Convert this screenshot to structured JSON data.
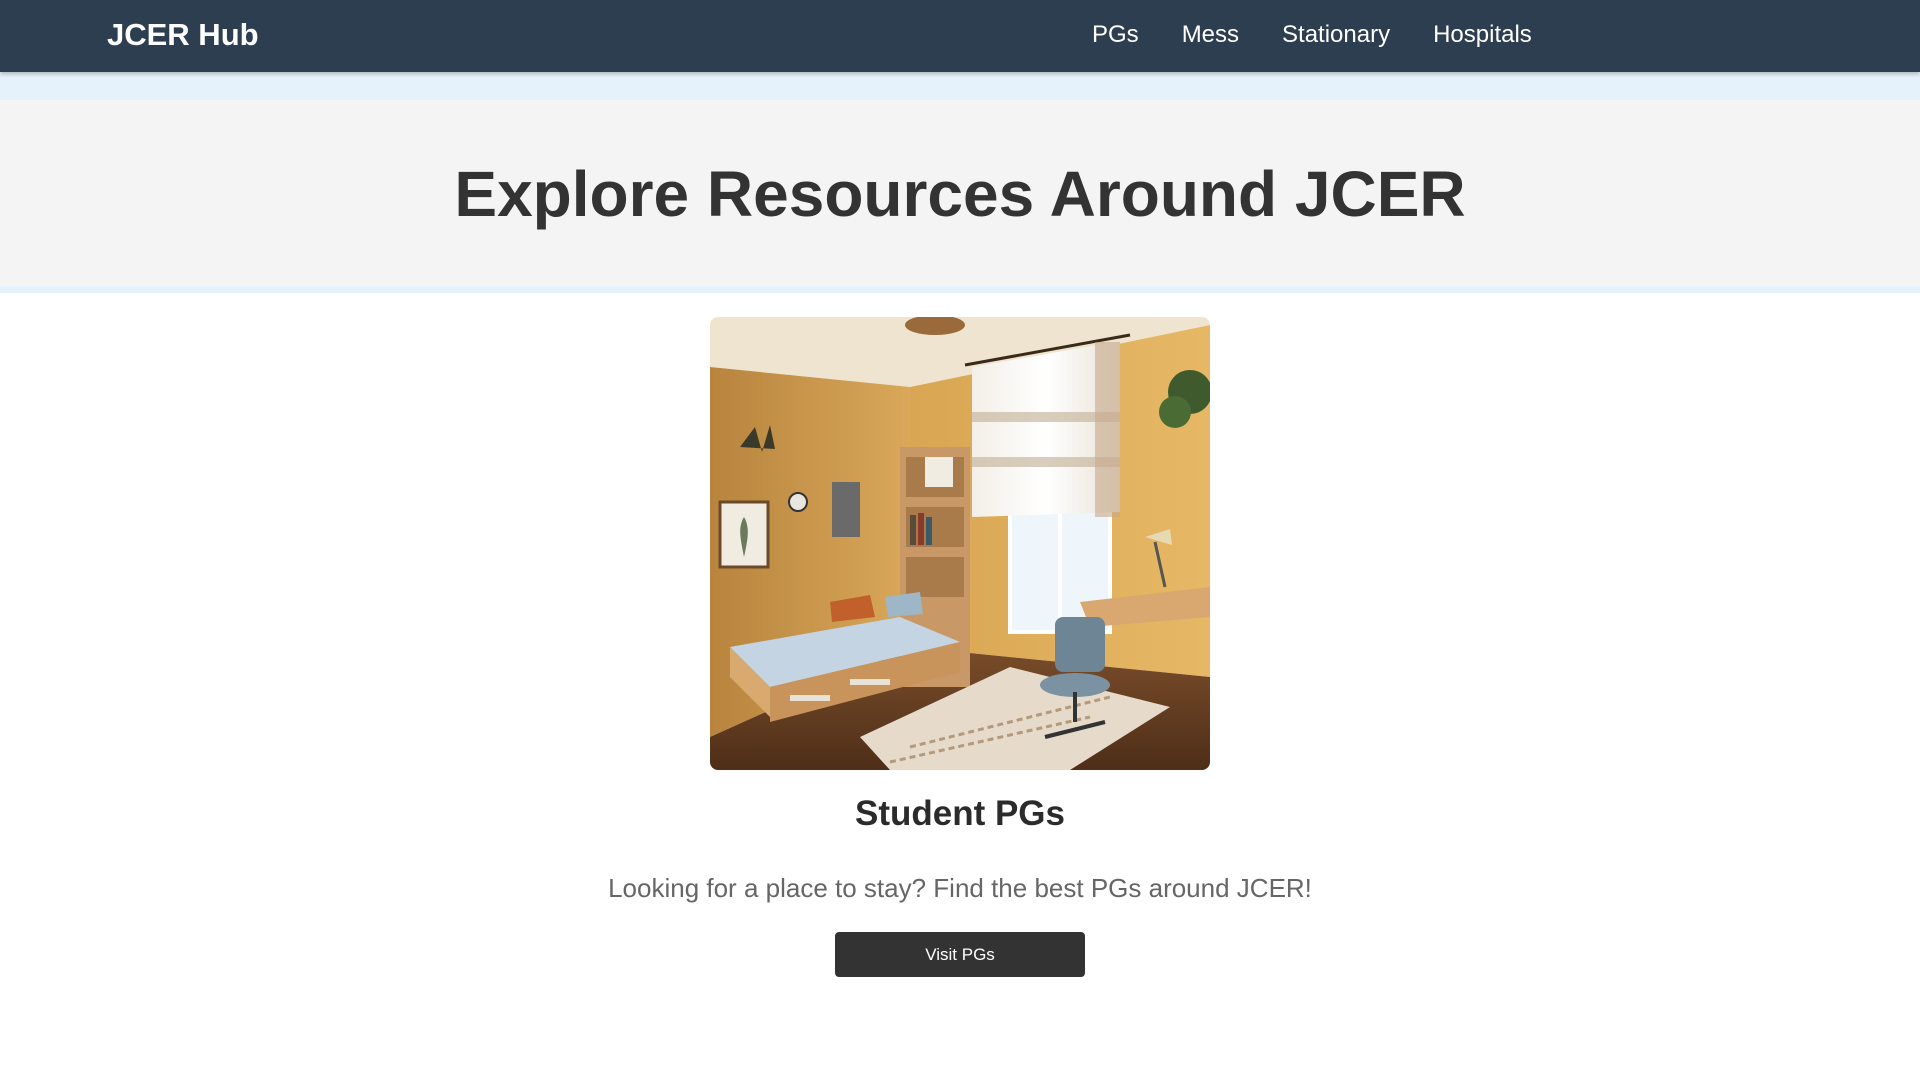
{
  "navbar": {
    "brand": "JCER Hub",
    "links": [
      {
        "label": "PGs"
      },
      {
        "label": "Mess"
      },
      {
        "label": "Stationary"
      },
      {
        "label": "Hospitals"
      }
    ]
  },
  "hero": {
    "title": "Explore Resources Around JCER"
  },
  "card": {
    "image_icon": "student-room-photo",
    "title": "Student PGs",
    "description": "Looking for a place to stay? Find the best PGs around JCER!",
    "button_label": "Visit PGs"
  },
  "colors": {
    "navbar_bg": "#2c3e50",
    "hero_bg": "#f4f4f4",
    "hero_band": "#e6f2fb",
    "button_bg": "#333333",
    "text_dark": "#333333",
    "text_muted": "#666666"
  }
}
